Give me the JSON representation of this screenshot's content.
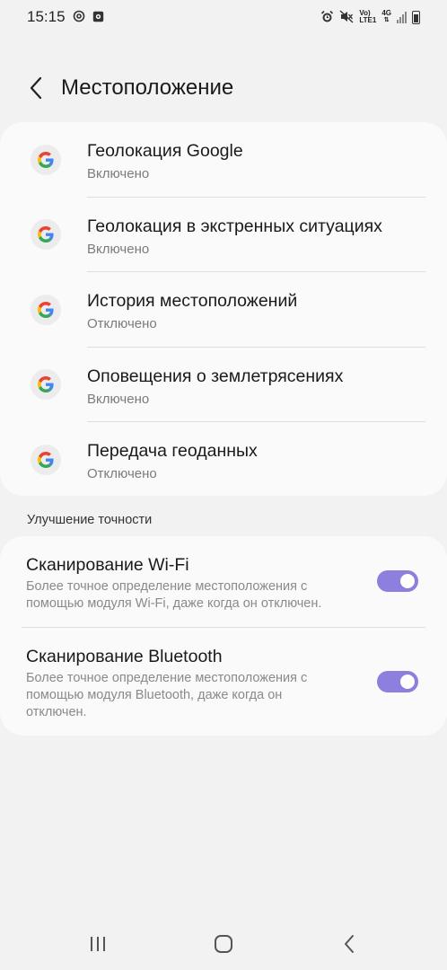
{
  "status_bar": {
    "time": "15:15",
    "lte_top": "Vo)",
    "lte_bottom": "LTE1",
    "network": "4G"
  },
  "header": {
    "title": "Местоположение"
  },
  "google_services": [
    {
      "title": "Геолокация Google",
      "status": "Включено"
    },
    {
      "title": "Геолокация в экстренных ситуациях",
      "status": "Включено"
    },
    {
      "title": "История местоположений",
      "status": "Отключено"
    },
    {
      "title": "Оповещения о землетрясениях",
      "status": "Включено"
    },
    {
      "title": "Передача геоданных",
      "status": "Отключено"
    }
  ],
  "accuracy_section": {
    "header": "Улучшение точности",
    "items": [
      {
        "title": "Сканирование Wi-Fi",
        "description": "Более точное определение местоположения с помощью модуля Wi-Fi, даже когда он отключен.",
        "enabled": true
      },
      {
        "title": "Сканирование Bluetooth",
        "description": "Более точное определение местоположения с помощью модуля Bluetooth, даже когда он отключен.",
        "enabled": true
      }
    ]
  },
  "colors": {
    "accent": "#8c7fde",
    "background": "#f2f2f2",
    "card": "#fafafa"
  },
  "icons": {
    "back": "chevron-left-icon",
    "google": "google-g-icon",
    "nav_recents": "recents-icon",
    "nav_home": "home-icon",
    "nav_back": "back-icon"
  }
}
